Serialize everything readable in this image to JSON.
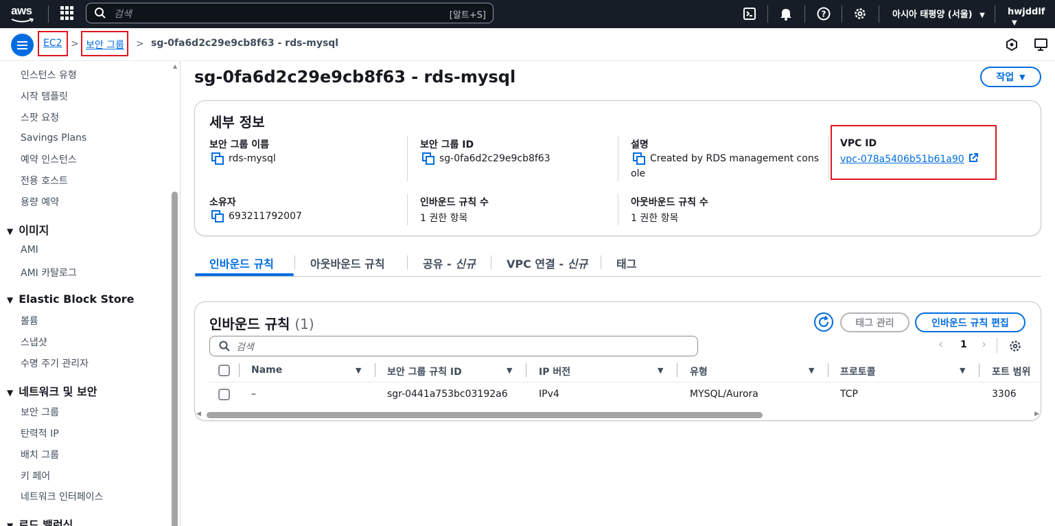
{
  "topnav": {
    "logo_text": "aws",
    "search_placeholder": "검색",
    "search_shortcut": "[알트+S]",
    "region": "아시아 태평양 (서울)",
    "user": "hwjddlf"
  },
  "breadcrumb": {
    "items": [
      "EC2",
      "보안 그룹"
    ],
    "current": "sg-0fa6d2c29e9cb8f63 - rds-mysql"
  },
  "sidebar": {
    "items_top": [
      "인스턴스 유형",
      "시작 템플릿",
      "스팟 요청",
      "Savings Plans",
      "예약 인스턴스",
      "전용 호스트",
      "용량 예약"
    ],
    "section_images": {
      "title": "이미지",
      "items": [
        "AMI",
        "AMI 카탈로그"
      ]
    },
    "section_ebs": {
      "title": "Elastic Block Store",
      "items": [
        "볼륨",
        "스냅샷",
        "수명 주기 관리자"
      ]
    },
    "section_network": {
      "title": "네트워크 및 보안",
      "items": [
        "보안 그룹",
        "탄력적 IP",
        "배치 그룹",
        "키 페어",
        "네트워크 인터페이스"
      ]
    },
    "section_lb": {
      "title": "로드 밸런싱"
    }
  },
  "page": {
    "title": "sg-0fa6d2c29e9cb8f63 - rds-mysql",
    "action_button": "작업"
  },
  "details": {
    "title": "세부 정보",
    "fields": {
      "sg_name_label": "보안 그룹 이름",
      "sg_name_value": "rds-mysql",
      "sg_id_label": "보안 그룹 ID",
      "sg_id_value": "sg-0fa6d2c29e9cb8f63",
      "desc_label": "설명",
      "desc_value_line1": "Created by RDS management cons",
      "desc_value_line2": "ole",
      "vpc_label": "VPC ID",
      "vpc_value": "vpc-078a5406b51b61a90",
      "owner_label": "소유자",
      "owner_value": "693211792007",
      "inbound_count_label": "인바운드 규칙 수",
      "inbound_count_value": "1 권한 항목",
      "outbound_count_label": "아웃바운드 규칙 수",
      "outbound_count_value": "1 권한 항목"
    }
  },
  "tabs": [
    {
      "label": "인바운드 규칙"
    },
    {
      "label": "아웃바운드 규칙"
    },
    {
      "label": "공유 - ",
      "italic": "신규"
    },
    {
      "label": "VPC 연결 - ",
      "italic": "신규"
    },
    {
      "label": "태그"
    }
  ],
  "rules": {
    "title": "인바운드 규칙",
    "count": "(1)",
    "manage_tags_button": "태그 관리",
    "edit_button": "인바운드 규칙 편집",
    "filter_placeholder": "검색",
    "page_number": "1",
    "columns": [
      "Name",
      "보안 그룹 규칙 ID",
      "IP 버전",
      "유형",
      "프로토콜",
      "포트 범위"
    ],
    "rows": [
      {
        "name": "–",
        "rule_id": "sgr-0441a753bc03192a6",
        "ip_version": "IPv4",
        "type": "MYSQL/Aurora",
        "protocol": "TCP",
        "port": "3306"
      }
    ]
  },
  "colors": {
    "nav_bg": "#161d26",
    "link_blue": "#006ce0",
    "highlight_red": "#e0141e"
  }
}
